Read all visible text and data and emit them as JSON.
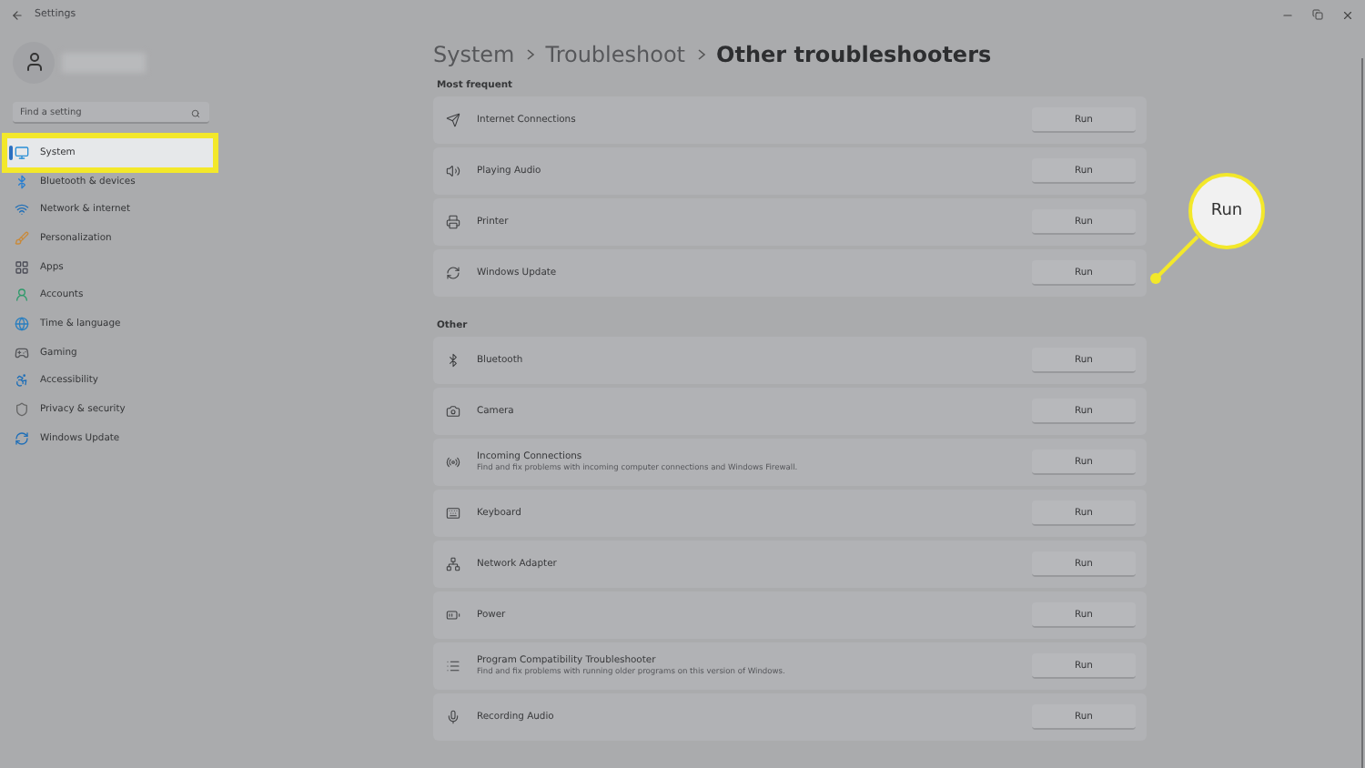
{
  "window": {
    "title": "Settings"
  },
  "search": {
    "placeholder": "Find a setting"
  },
  "nav": [
    {
      "label": "System",
      "selected": true
    },
    {
      "label": "Bluetooth & devices",
      "selected": false
    },
    {
      "label": "Network & internet",
      "selected": false
    },
    {
      "label": "Personalization",
      "selected": false
    },
    {
      "label": "Apps",
      "selected": false
    },
    {
      "label": "Accounts",
      "selected": false
    },
    {
      "label": "Time & language",
      "selected": false
    },
    {
      "label": "Gaming",
      "selected": false
    },
    {
      "label": "Accessibility",
      "selected": false
    },
    {
      "label": "Privacy & security",
      "selected": false
    },
    {
      "label": "Windows Update",
      "selected": false
    }
  ],
  "breadcrumb": [
    "System",
    "Troubleshoot",
    "Other troubleshooters"
  ],
  "sections": [
    {
      "title": "Most frequent",
      "items": [
        {
          "name": "Internet Connections",
          "button": "Run"
        },
        {
          "name": "Playing Audio",
          "button": "Run"
        },
        {
          "name": "Printer",
          "button": "Run"
        },
        {
          "name": "Windows Update",
          "button": "Run"
        }
      ]
    },
    {
      "title": "Other",
      "items": [
        {
          "name": "Bluetooth",
          "button": "Run"
        },
        {
          "name": "Camera",
          "button": "Run"
        },
        {
          "name": "Incoming Connections",
          "description": "Find and fix problems with incoming computer connections and Windows Firewall.",
          "button": "Run"
        },
        {
          "name": "Keyboard",
          "button": "Run"
        },
        {
          "name": "Network Adapter",
          "button": "Run"
        },
        {
          "name": "Power",
          "button": "Run"
        },
        {
          "name": "Program Compatibility Troubleshooter",
          "description": "Find and fix problems with running older programs on this version of Windows.",
          "button": "Run"
        },
        {
          "name": "Recording Audio",
          "button": "Run"
        }
      ]
    }
  ],
  "callout": {
    "text": "Run"
  }
}
